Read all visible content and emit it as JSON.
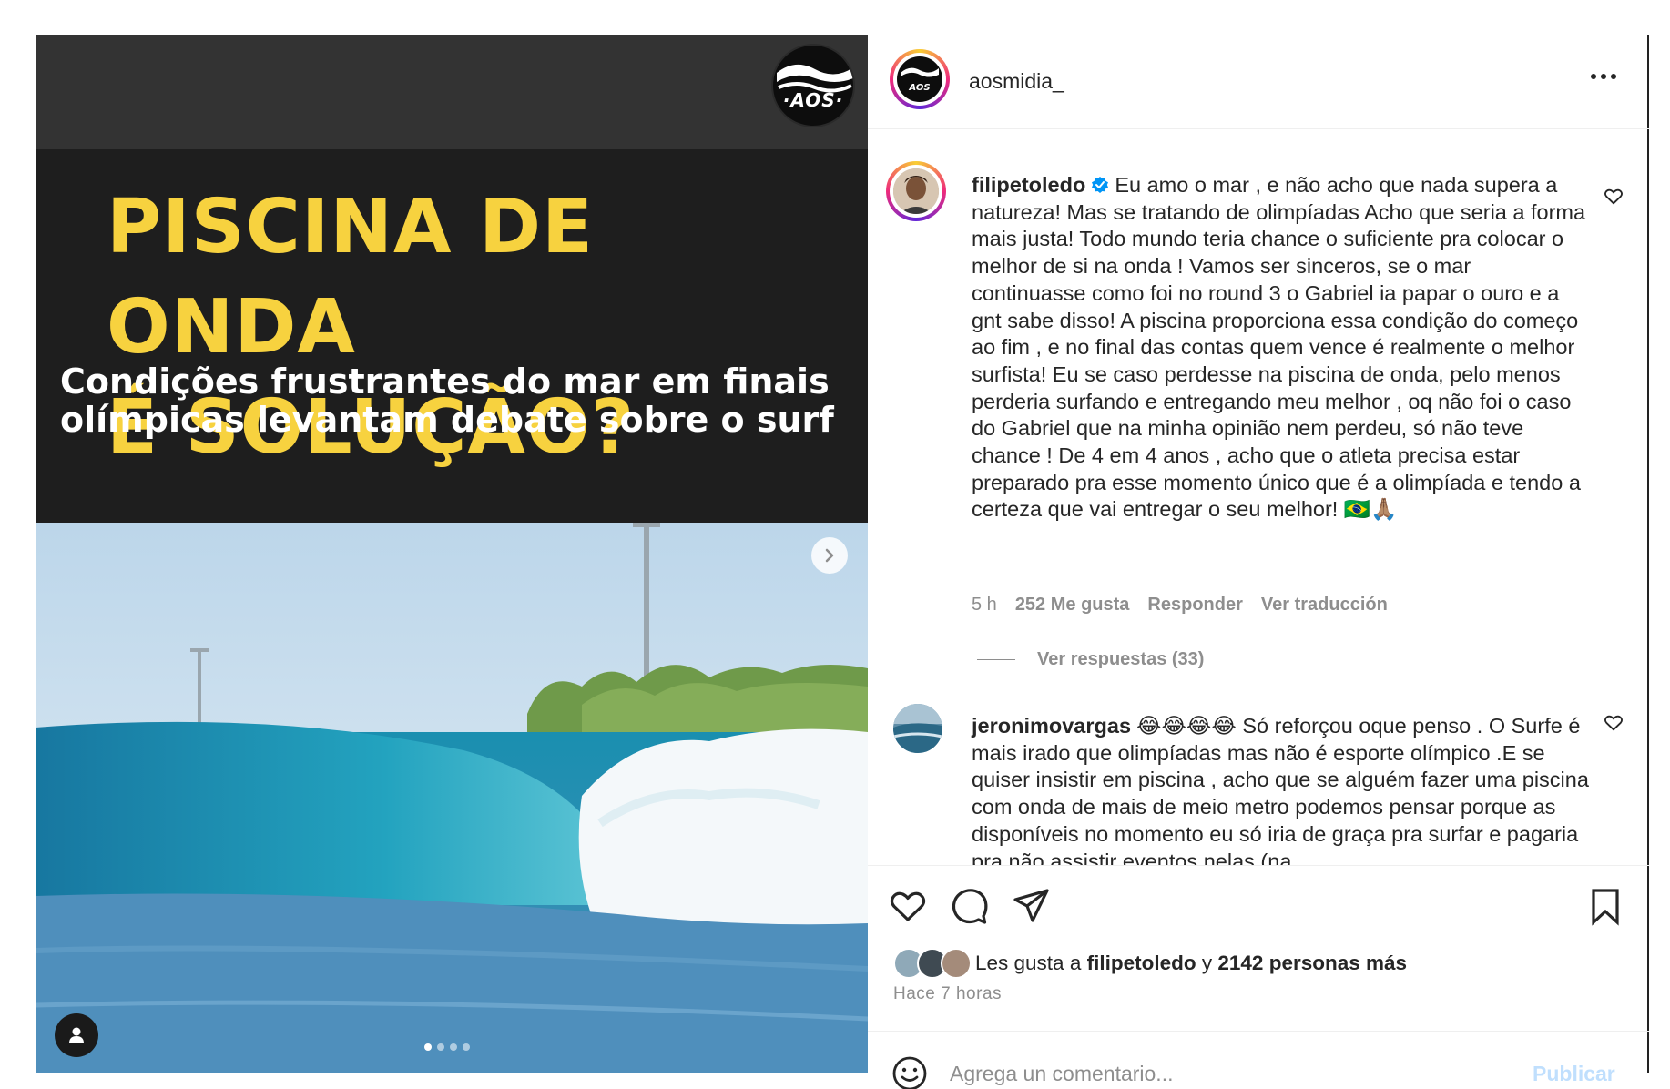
{
  "post": {
    "headline": "PISCINA DE ONDA\nÉ SOLUÇÃO?",
    "subhead": "Condições frustrantes do mar em finais olímpicas levantam debate sobre o surf",
    "logo_text": "·AOS·",
    "slide_count": 4,
    "active_slide": 1
  },
  "header": {
    "username": "aosmidia_"
  },
  "comments": [
    {
      "username": "filipetoledo",
      "verified": true,
      "text": "Eu amo o mar , e não acho que nada supera a natureza! Mas se tratando de olimpíadas Acho que seria a forma mais justa! Todo mundo teria chance o suficiente pra colocar o melhor de si na onda ! Vamos ser sinceros, se o mar continuasse como foi no round 3 o Gabriel ia papar o ouro e a gnt sabe disso! A piscina proporciona essa condição do começo ao fim , e no final das contas quem vence é realmente o melhor surfista! Eu se caso perdesse na piscina de onda, pelo menos perderia surfando e entregando meu melhor , oq não foi o caso do Gabriel que na minha opinião nem perdeu, só não teve chance ! De 4 em 4 anos , acho que o atleta precisa estar preparado pra esse momento único que é a olimpíada e tendo a certeza que vai entregar o seu melhor! 🇧🇷🙏🏽",
      "time": "5 h",
      "likes": "252 Me gusta",
      "reply": "Responder",
      "translate": "Ver traducción",
      "view_replies": "Ver respuestas (33)"
    },
    {
      "username": "jeronimovargas",
      "verified": false,
      "text": "😂😂😂😂 Só reforçou oque penso . O Surfe é mais irado que olimpíadas mas não é esporte olímpico .E se quiser insistir em piscina , acho que se alguém fazer uma piscina com onda de mais de meio metro podemos pensar porque as disponíveis no momento eu só iria de graça pra surfar e pagaria pra não assistir eventos nelas (na"
    }
  ],
  "likes_bar": {
    "prefix": "Les gusta a",
    "user": "filipetoledo",
    "conj": "y",
    "others": "2142 personas más",
    "time_ago": "Hace 7 horas"
  },
  "add_comment": {
    "placeholder": "Agrega un comentario...",
    "publish": "Publicar"
  },
  "colors": {
    "headline": "#f7d23f",
    "link_disabled": "#c0dffd",
    "muted": "#8e8e8e",
    "verified": "#0095f6"
  }
}
